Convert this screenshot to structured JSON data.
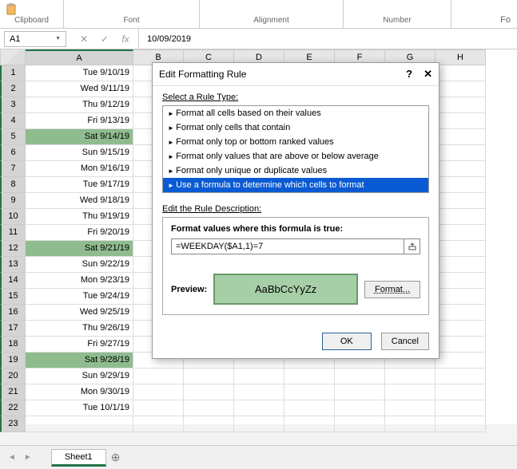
{
  "ribbon": {
    "clipboard": "Clipboard",
    "font": "Font",
    "alignment": "Alignment",
    "number": "Number",
    "fo": "Fo"
  },
  "namebox": {
    "cell": "A1",
    "cancel": "✕",
    "enter": "✓",
    "fx": "fx"
  },
  "formula_bar": "10/09/2019",
  "columns": [
    "A",
    "B",
    "C",
    "D",
    "E",
    "F",
    "G",
    "H"
  ],
  "rows": [
    {
      "n": 1,
      "date": "Tue 9/10/19",
      "hl": false
    },
    {
      "n": 2,
      "date": "Wed 9/11/19",
      "hl": false
    },
    {
      "n": 3,
      "date": "Thu 9/12/19",
      "hl": false
    },
    {
      "n": 4,
      "date": "Fri 9/13/19",
      "hl": false
    },
    {
      "n": 5,
      "date": "Sat 9/14/19",
      "hl": true
    },
    {
      "n": 6,
      "date": "Sun 9/15/19",
      "hl": false
    },
    {
      "n": 7,
      "date": "Mon 9/16/19",
      "hl": false
    },
    {
      "n": 8,
      "date": "Tue 9/17/19",
      "hl": false
    },
    {
      "n": 9,
      "date": "Wed 9/18/19",
      "hl": false
    },
    {
      "n": 10,
      "date": "Thu 9/19/19",
      "hl": false
    },
    {
      "n": 11,
      "date": "Fri 9/20/19",
      "hl": false
    },
    {
      "n": 12,
      "date": "Sat 9/21/19",
      "hl": true
    },
    {
      "n": 13,
      "date": "Sun 9/22/19",
      "hl": false
    },
    {
      "n": 14,
      "date": "Mon 9/23/19",
      "hl": false
    },
    {
      "n": 15,
      "date": "Tue 9/24/19",
      "hl": false
    },
    {
      "n": 16,
      "date": "Wed 9/25/19",
      "hl": false
    },
    {
      "n": 17,
      "date": "Thu 9/26/19",
      "hl": false
    },
    {
      "n": 18,
      "date": "Fri 9/27/19",
      "hl": false
    },
    {
      "n": 19,
      "date": "Sat 9/28/19",
      "hl": true
    },
    {
      "n": 20,
      "date": "Sun 9/29/19",
      "hl": false
    },
    {
      "n": 21,
      "date": "Mon 9/30/19",
      "hl": false
    },
    {
      "n": 22,
      "date": "Tue 10/1/19",
      "hl": false
    },
    {
      "n": 23,
      "date": "",
      "hl": false
    }
  ],
  "sheet_tab": "Sheet1",
  "add_sheet": "⊕",
  "dialog": {
    "title": "Edit Formatting Rule",
    "help": "?",
    "close": "✕",
    "select_label": "Select a Rule Type:",
    "rules": [
      "Format all cells based on their values",
      "Format only cells that contain",
      "Format only top or bottom ranked values",
      "Format only values that are above or below average",
      "Format only unique or duplicate values",
      "Use a formula to determine which cells to format"
    ],
    "selected_rule_index": 5,
    "desc_label": "Edit the Rule Description:",
    "formula_label": "Format values where this formula is true:",
    "formula_value": "=WEEKDAY($A1,1)=7",
    "preview_label": "Preview:",
    "preview_text": "AaBbCcYyZz",
    "format_btn": "Format...",
    "ok": "OK",
    "cancel": "Cancel"
  }
}
